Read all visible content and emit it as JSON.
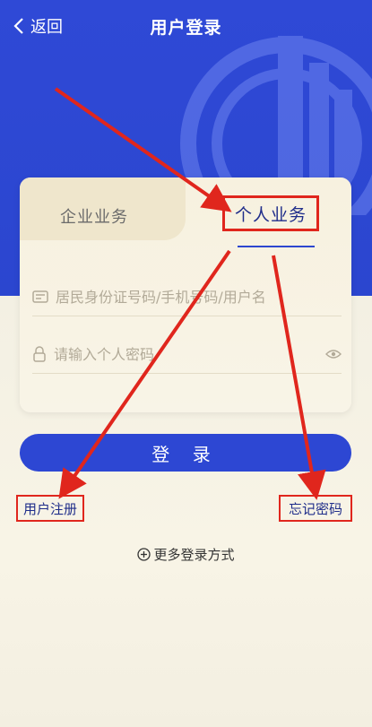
{
  "header": {
    "back_label": "返回",
    "title": "用户登录"
  },
  "tabs": {
    "enterprise": "企业业务",
    "personal": "个人业务"
  },
  "form": {
    "id_placeholder": "居民身份证号码/手机号码/用户名",
    "password_placeholder": "请输入个人密码"
  },
  "actions": {
    "login_label": "登 录",
    "register_label": "用户注册",
    "forgot_label": "忘记密码",
    "more_login_label": "更多登录方式"
  },
  "colors": {
    "brand_blue": "#2d47d3",
    "annotation_red": "#e0261d",
    "card_bg": "#f7f1df"
  }
}
